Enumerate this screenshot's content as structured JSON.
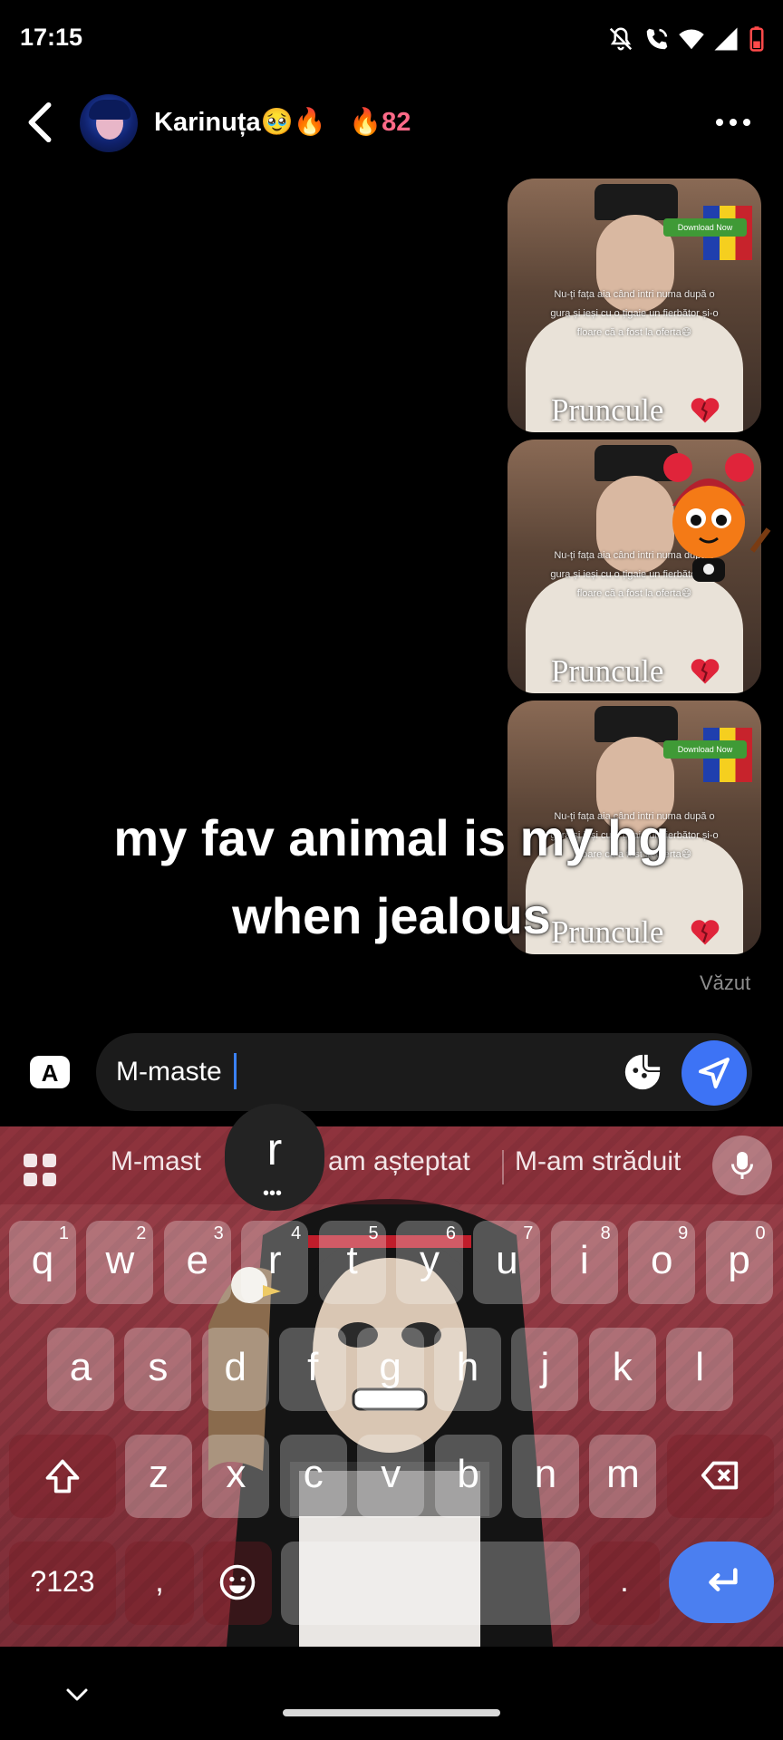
{
  "status_bar": {
    "time": "17:15",
    "icons": [
      "mute-icon",
      "wifi-call-icon",
      "wifi-icon",
      "signal-icon",
      "battery-low-icon"
    ]
  },
  "header": {
    "contact_name": "Karinuța🥹🔥",
    "streak": "🔥82",
    "icons": [
      "back-icon",
      "more-icon"
    ]
  },
  "messages": [
    {
      "caption": "Nu-ți fața aia când intri numa după o gura și ieși cu o țigaie un fierbător și-o floare că a fost la oferta😄",
      "watermark_text": "Pruncule",
      "badge": "Download Now"
    },
    {
      "caption": "Nu-ți fața aia când intri numa după o gura și ieși cu o țigaie un fierbător și-o floare că a fost la oferta😄",
      "watermark_text": "Pruncule",
      "badge": ""
    },
    {
      "caption": "Nu-ți fața aia când intri numa după o gura și ieși cu o țigaie un fierbător și-o floare că a fost la oferta😄",
      "watermark_text": "Pruncule",
      "badge": "Download Now"
    }
  ],
  "overlay_caption": "my fav animal is my hg when jealous",
  "seen_label": "Văzut",
  "composer": {
    "text": "M-maste",
    "icons": [
      "keyboard-a-icon",
      "sticker-icon",
      "send-icon"
    ]
  },
  "keyboard": {
    "suggestions": [
      "M-mast",
      "am așteptat",
      "M-am străduit"
    ],
    "popup_key": "r",
    "row1": [
      {
        "k": "q",
        "h": "1"
      },
      {
        "k": "w",
        "h": "2"
      },
      {
        "k": "e",
        "h": "3"
      },
      {
        "k": "r",
        "h": "4"
      },
      {
        "k": "t",
        "h": "5"
      },
      {
        "k": "y",
        "h": "6"
      },
      {
        "k": "u",
        "h": "7"
      },
      {
        "k": "i",
        "h": "8"
      },
      {
        "k": "o",
        "h": "9"
      },
      {
        "k": "p",
        "h": "0"
      }
    ],
    "row2": [
      "a",
      "s",
      "d",
      "f",
      "g",
      "h",
      "j",
      "k",
      "l"
    ],
    "row3": [
      "z",
      "x",
      "c",
      "v",
      "b",
      "n",
      "m"
    ],
    "symbols_key": "?123",
    "comma_key": ",",
    "period_key": ".",
    "icons": [
      "apps-grid-icon",
      "mic-icon",
      "shift-icon",
      "backspace-icon",
      "emoji-icon",
      "enter-icon"
    ]
  },
  "colors": {
    "send_button": "#3d73f5",
    "enter_key": "#4b7ff0",
    "streak": "#ff6a88",
    "keyboard_bg": "#8a343e"
  }
}
